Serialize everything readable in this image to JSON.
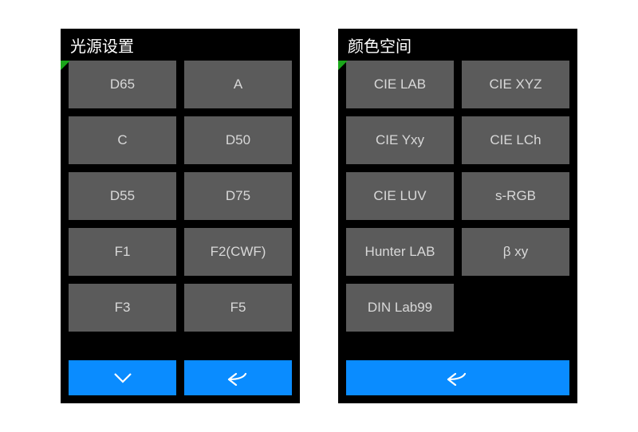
{
  "panels": {
    "left": {
      "title": "光源设置",
      "options": [
        "D65",
        "A",
        "C",
        "D50",
        "D55",
        "D75",
        "F1",
        "F2(CWF)",
        "F3",
        "F5"
      ],
      "footer": {
        "type": "two",
        "down_label": "expand-more",
        "back_label": "back"
      }
    },
    "right": {
      "title": "颜色空间",
      "options": [
        "CIE LAB",
        "CIE XYZ",
        "CIE Yxy",
        "CIE LCh",
        "CIE LUV",
        "s-RGB",
        "Hunter LAB",
        "β xy",
        "DIN Lab99"
      ],
      "footer": {
        "type": "one",
        "back_label": "back"
      }
    }
  },
  "colors": {
    "accent": "#0a8cff",
    "button": "#5b5b5b",
    "corner": "#1aa61a"
  }
}
